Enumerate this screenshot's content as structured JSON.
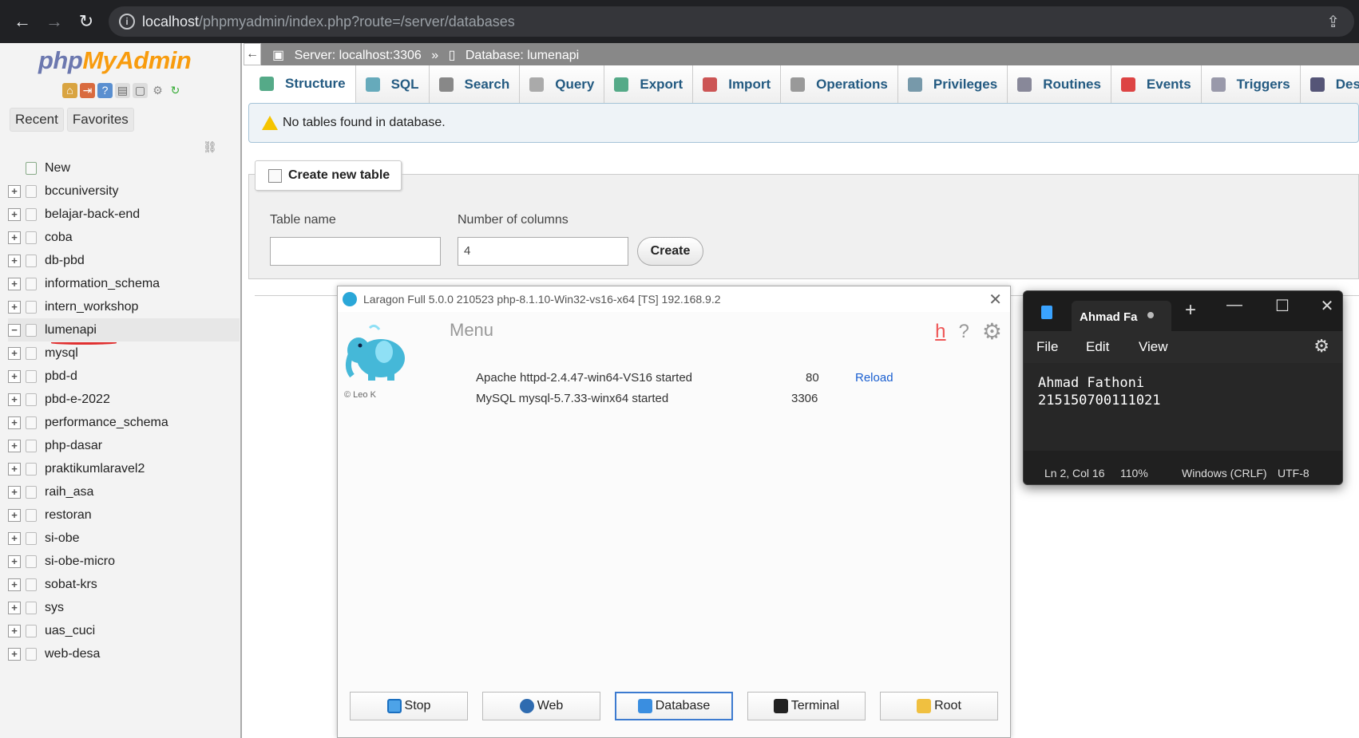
{
  "browser": {
    "url_host": "localhost",
    "url_path": "/phpmyadmin/index.php?route=/server/databases"
  },
  "sidebar": {
    "logo": {
      "php": "php",
      "my": "My",
      "admin": "Admin"
    },
    "tabs": [
      "Recent",
      "Favorites"
    ],
    "new_label": "New",
    "databases": [
      "bccuniversity",
      "belajar-back-end",
      "coba",
      "db-pbd",
      "information_schema",
      "intern_workshop",
      "lumenapi",
      "mysql",
      "pbd-d",
      "pbd-e-2022",
      "performance_schema",
      "php-dasar",
      "praktikumlaravel2",
      "raih_asa",
      "restoran",
      "si-obe",
      "si-obe-micro",
      "sobat-krs",
      "sys",
      "uas_cuci",
      "web-desa"
    ],
    "selected_database": "lumenapi"
  },
  "breadcrumb": {
    "server": "Server: localhost:3306",
    "separator": "»",
    "database": "Database: lumenapi"
  },
  "tabs": [
    "Structure",
    "SQL",
    "Search",
    "Query",
    "Export",
    "Import",
    "Operations",
    "Privileges",
    "Routines",
    "Events",
    "Triggers",
    "Des"
  ],
  "notice": "No tables found in database.",
  "create_table": {
    "legend": "Create new table",
    "table_name_label": "Table name",
    "table_name_value": "",
    "columns_label": "Number of columns",
    "columns_value": "4",
    "button": "Create"
  },
  "laragon": {
    "title": "Laragon Full 5.0.0 210523 php-8.1.10-Win32-vs16-x64 [TS]  192.168.9.2",
    "menu_label": "Menu",
    "credit": "© Leo K",
    "top_icons": {
      "h": "h",
      "help": "?"
    },
    "services": [
      {
        "name": "Apache httpd-2.4.47-win64-VS16 started",
        "port": "80",
        "action": "Reload"
      },
      {
        "name": "MySQL mysql-5.7.33-winx64 started",
        "port": "3306"
      }
    ],
    "buttons": [
      "Stop",
      "Web",
      "Database",
      "Terminal",
      "Root"
    ]
  },
  "notepad": {
    "tab_title": "Ahmad Fa",
    "menus": [
      "File",
      "Edit",
      "View"
    ],
    "content_line1": "Ahmad Fathoni",
    "content_line2": "215150700111021",
    "status": {
      "position": "Ln 2, Col 16",
      "zoom": "110%",
      "line_ending": "Windows (CRLF)",
      "encoding": "UTF-8"
    }
  }
}
